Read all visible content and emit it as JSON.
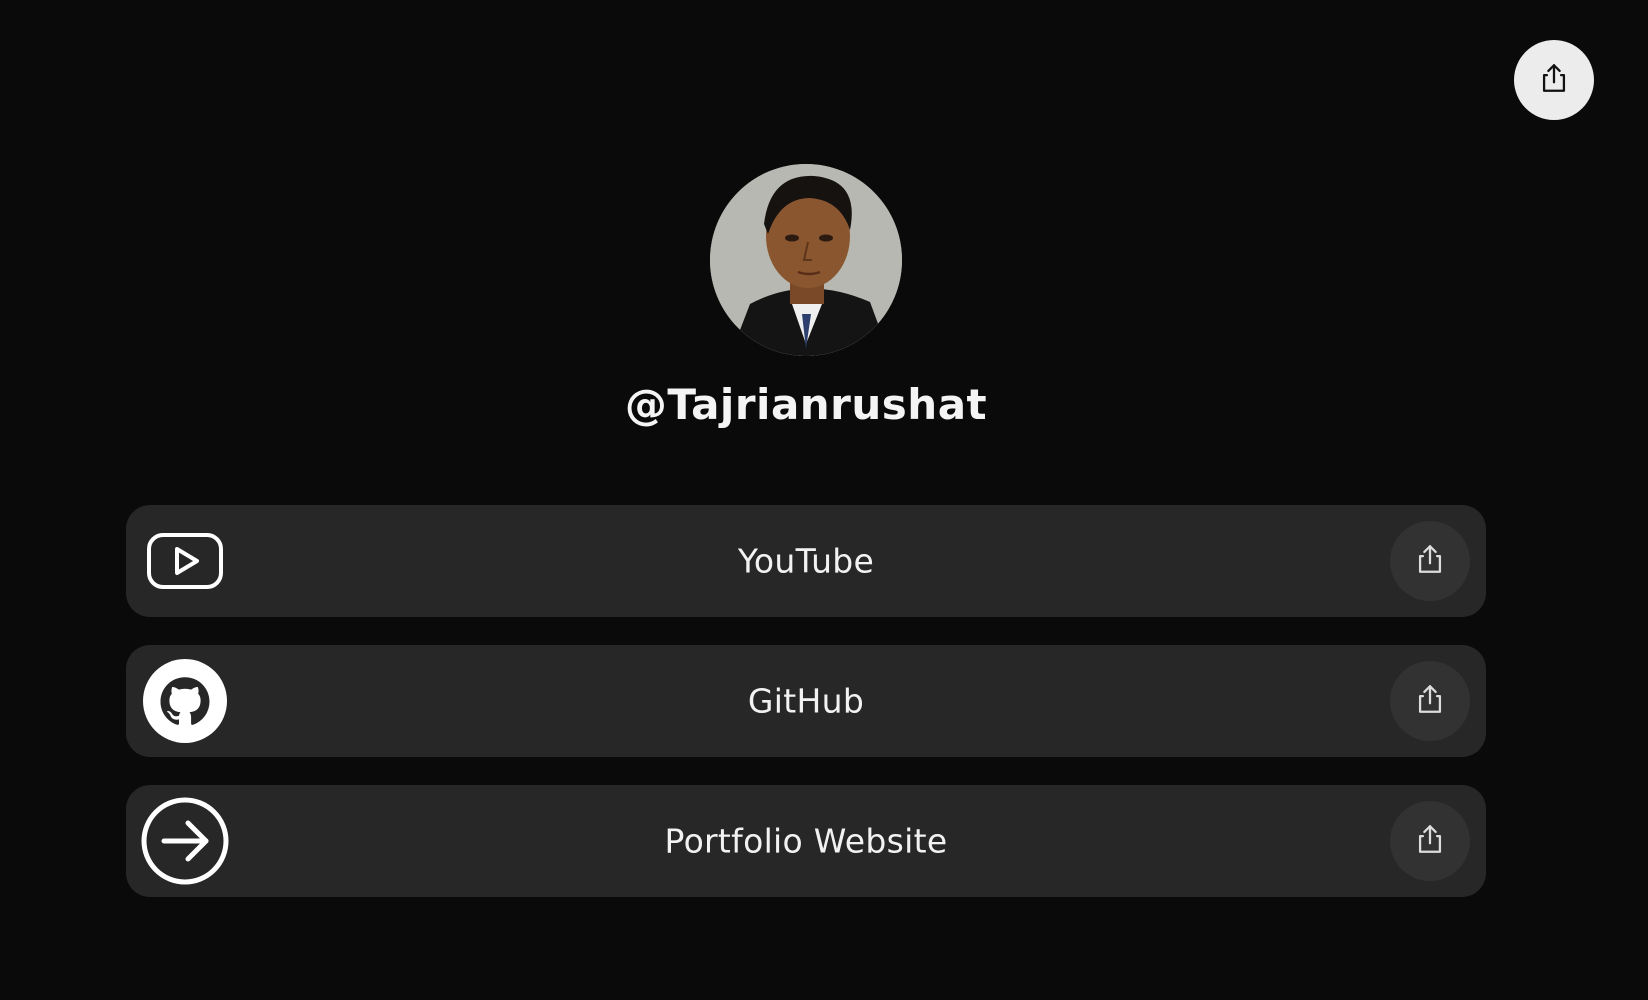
{
  "profile": {
    "handle": "@Tajrianrushat",
    "avatar_icon": "profile-photo"
  },
  "header": {
    "share_icon": "share-icon"
  },
  "links": [
    {
      "label": "YouTube",
      "icon": "youtube-icon",
      "share_icon": "share-icon"
    },
    {
      "label": "GitHub",
      "icon": "github-icon",
      "share_icon": "share-icon"
    },
    {
      "label": "Portfolio Website",
      "icon": "arrow-right-circle-icon",
      "share_icon": "share-icon"
    }
  ],
  "colors": {
    "background": "#0a0a0a",
    "card": "#272727",
    "card_share_button": "#323232",
    "top_share_button": "#ececec",
    "text": "#f2f2f2"
  }
}
